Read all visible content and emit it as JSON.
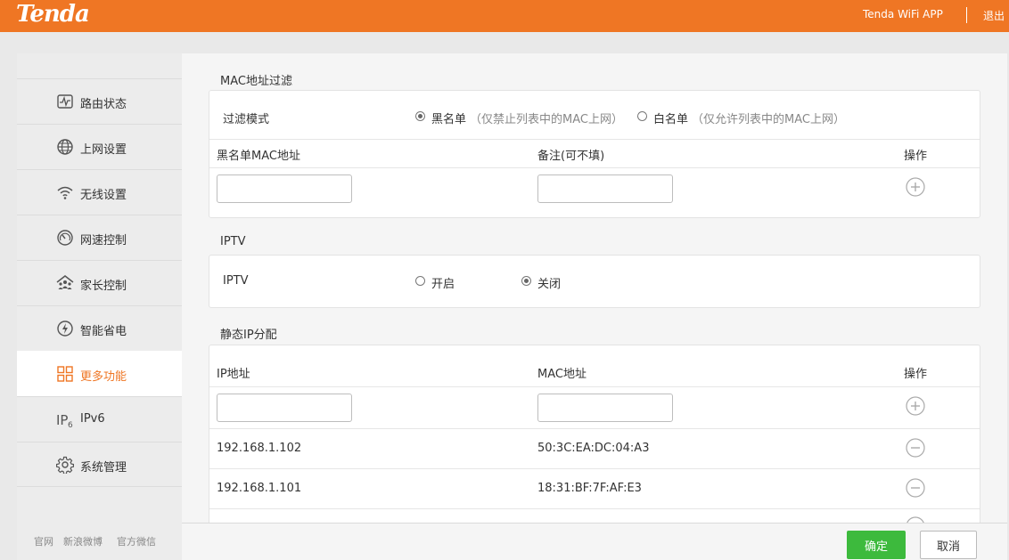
{
  "header": {
    "logo": "Tenda",
    "app_link": "Tenda WiFi APP",
    "logout": "退出",
    "colors": {
      "brand": "#ef7624"
    }
  },
  "sidebar": {
    "items": [
      {
        "label": "路由状态",
        "icon": "pulse-monitor-icon"
      },
      {
        "label": "上网设置",
        "icon": "globe-icon"
      },
      {
        "label": "无线设置",
        "icon": "wifi-icon"
      },
      {
        "label": "网速控制",
        "icon": "speedometer-icon"
      },
      {
        "label": "家长控制",
        "icon": "family-icon"
      },
      {
        "label": "智能省电",
        "icon": "power-save-icon"
      },
      {
        "label": "更多功能",
        "icon": "grid-icon",
        "active": true
      },
      {
        "label": "IPv6",
        "icon": "ipv6-icon"
      },
      {
        "label": "系统管理",
        "icon": "gear-icon"
      }
    ],
    "footer_links": [
      "官网",
      "新浪微博",
      "官方微信"
    ]
  },
  "mac_filter": {
    "title": "MAC地址过滤",
    "mode_label": "过滤模式",
    "blacklist_label": "黑名单",
    "blacklist_hint": "（仅禁止列表中的MAC上网）",
    "whitelist_label": "白名单",
    "whitelist_hint": "（仅允许列表中的MAC上网）",
    "selected_mode": "黑名单",
    "col_mac": "黑名单MAC地址",
    "col_note": "备注(可不填)",
    "col_action": "操作"
  },
  "iptv": {
    "title": "IPTV",
    "label": "IPTV",
    "on_label": "开启",
    "off_label": "关闭",
    "selected": "关闭"
  },
  "static_ip": {
    "title": "静态IP分配",
    "col_ip": "IP地址",
    "col_mac": "MAC地址",
    "col_action": "操作",
    "rows": [
      {
        "ip": "192.168.1.102",
        "mac": "50:3C:EA:DC:04:A3"
      },
      {
        "ip": "192.168.1.101",
        "mac": "18:31:BF:7F:AF:E3"
      }
    ]
  },
  "footer": {
    "ok": "确定",
    "cancel": "取消"
  }
}
